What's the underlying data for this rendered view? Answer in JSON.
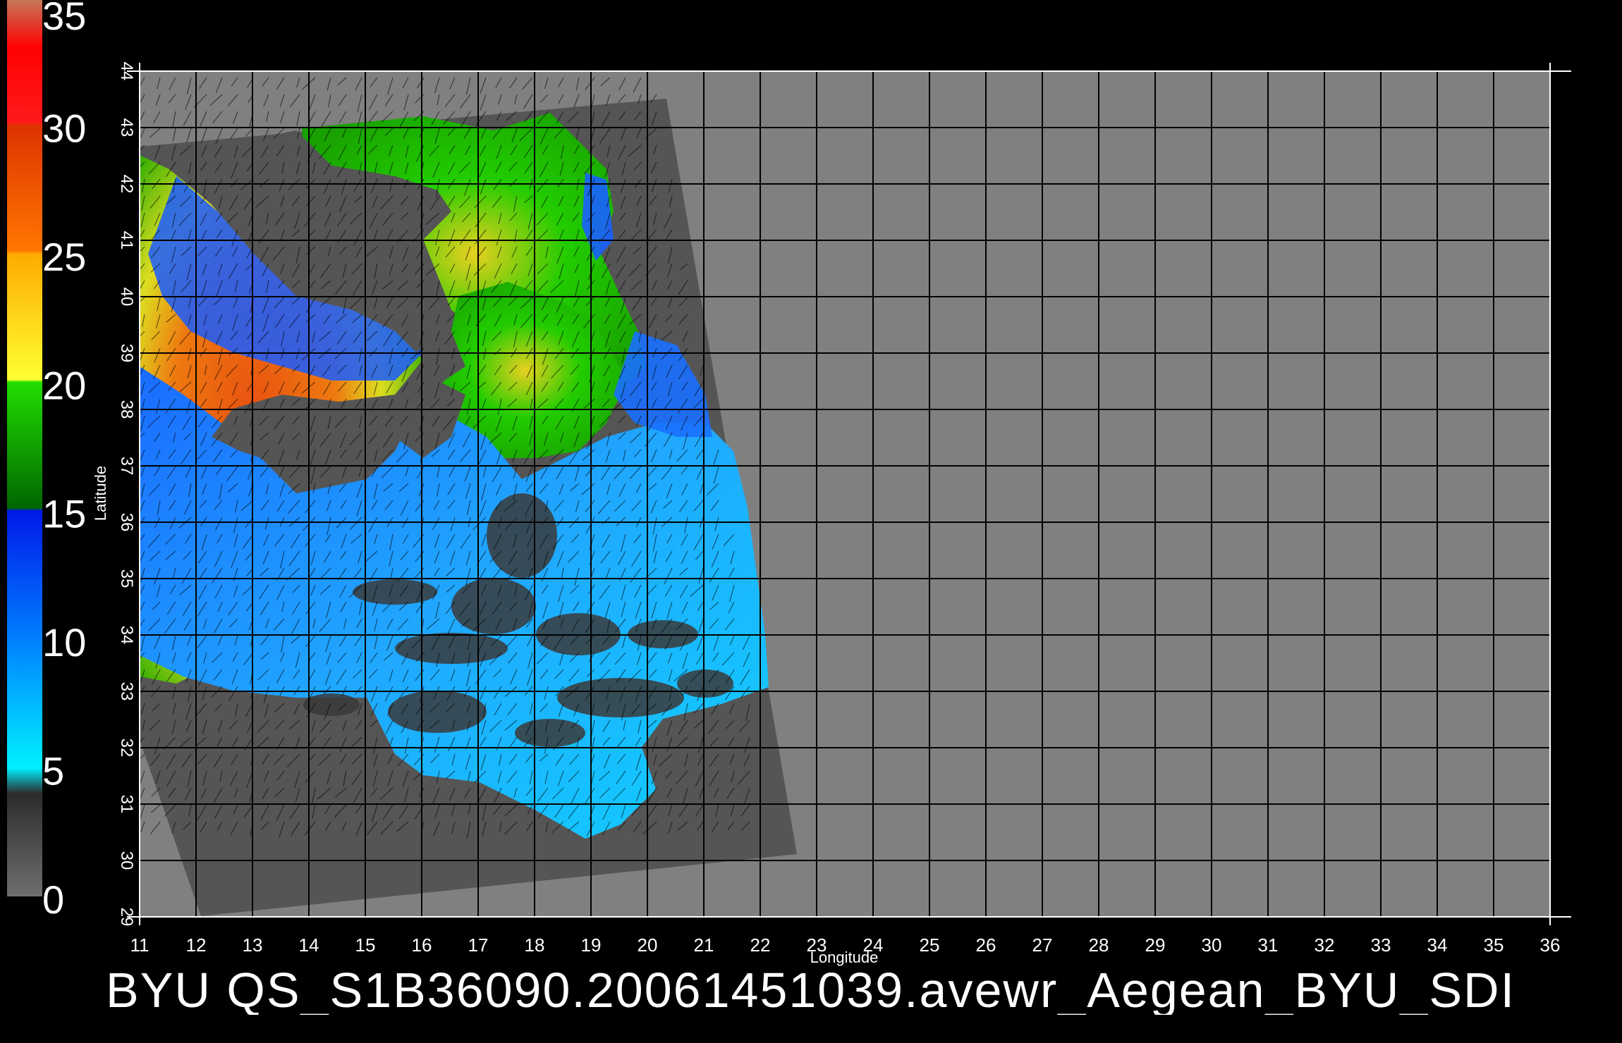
{
  "footer": {
    "title": "BYU  QS_S1B36090.20061451039.avewr_Aegean_BYU_SDI"
  },
  "axes": {
    "xlabel": "Longitude",
    "ylabel": "Latitude",
    "lon_range": [
      11,
      36
    ],
    "lat_range": [
      29,
      44
    ],
    "lon_ticks": [
      "11",
      "12",
      "13",
      "14",
      "15",
      "16",
      "17",
      "18",
      "19",
      "20",
      "21",
      "22",
      "23",
      "24",
      "25",
      "26",
      "27",
      "28",
      "29",
      "30",
      "31",
      "32",
      "33",
      "34",
      "35",
      "36"
    ],
    "lat_ticks": [
      "29",
      "30",
      "31",
      "32",
      "33",
      "34",
      "35",
      "36",
      "37",
      "38",
      "39",
      "40",
      "41",
      "42",
      "43",
      "44"
    ],
    "grid": true
  },
  "colorbar": {
    "labels": [
      "0",
      "5",
      "10",
      "15",
      "20",
      "25",
      "30",
      "35"
    ],
    "stops": [
      {
        "value": 0,
        "color": "#6e6e6e"
      },
      {
        "value": 4,
        "color": "#2c2c2c"
      },
      {
        "value": 5,
        "color": "#00f0ff"
      },
      {
        "value": 10,
        "color": "#0080ff"
      },
      {
        "value": 15,
        "color": "#0018e8"
      },
      {
        "value": 15.1,
        "color": "#006600"
      },
      {
        "value": 20,
        "color": "#22dd00"
      },
      {
        "value": 20.1,
        "color": "#ffff33"
      },
      {
        "value": 25,
        "color": "#ffaa00"
      },
      {
        "value": 25.1,
        "color": "#ff7700"
      },
      {
        "value": 30,
        "color": "#dd3300"
      },
      {
        "value": 30.1,
        "color": "#ff1a1a"
      },
      {
        "value": 33,
        "color": "#ff0000"
      },
      {
        "value": 35,
        "color": "#c08060"
      }
    ]
  },
  "colors": {
    "background": "#808080",
    "swath": "#555555",
    "land": "#575757",
    "grid": "#000000"
  }
}
